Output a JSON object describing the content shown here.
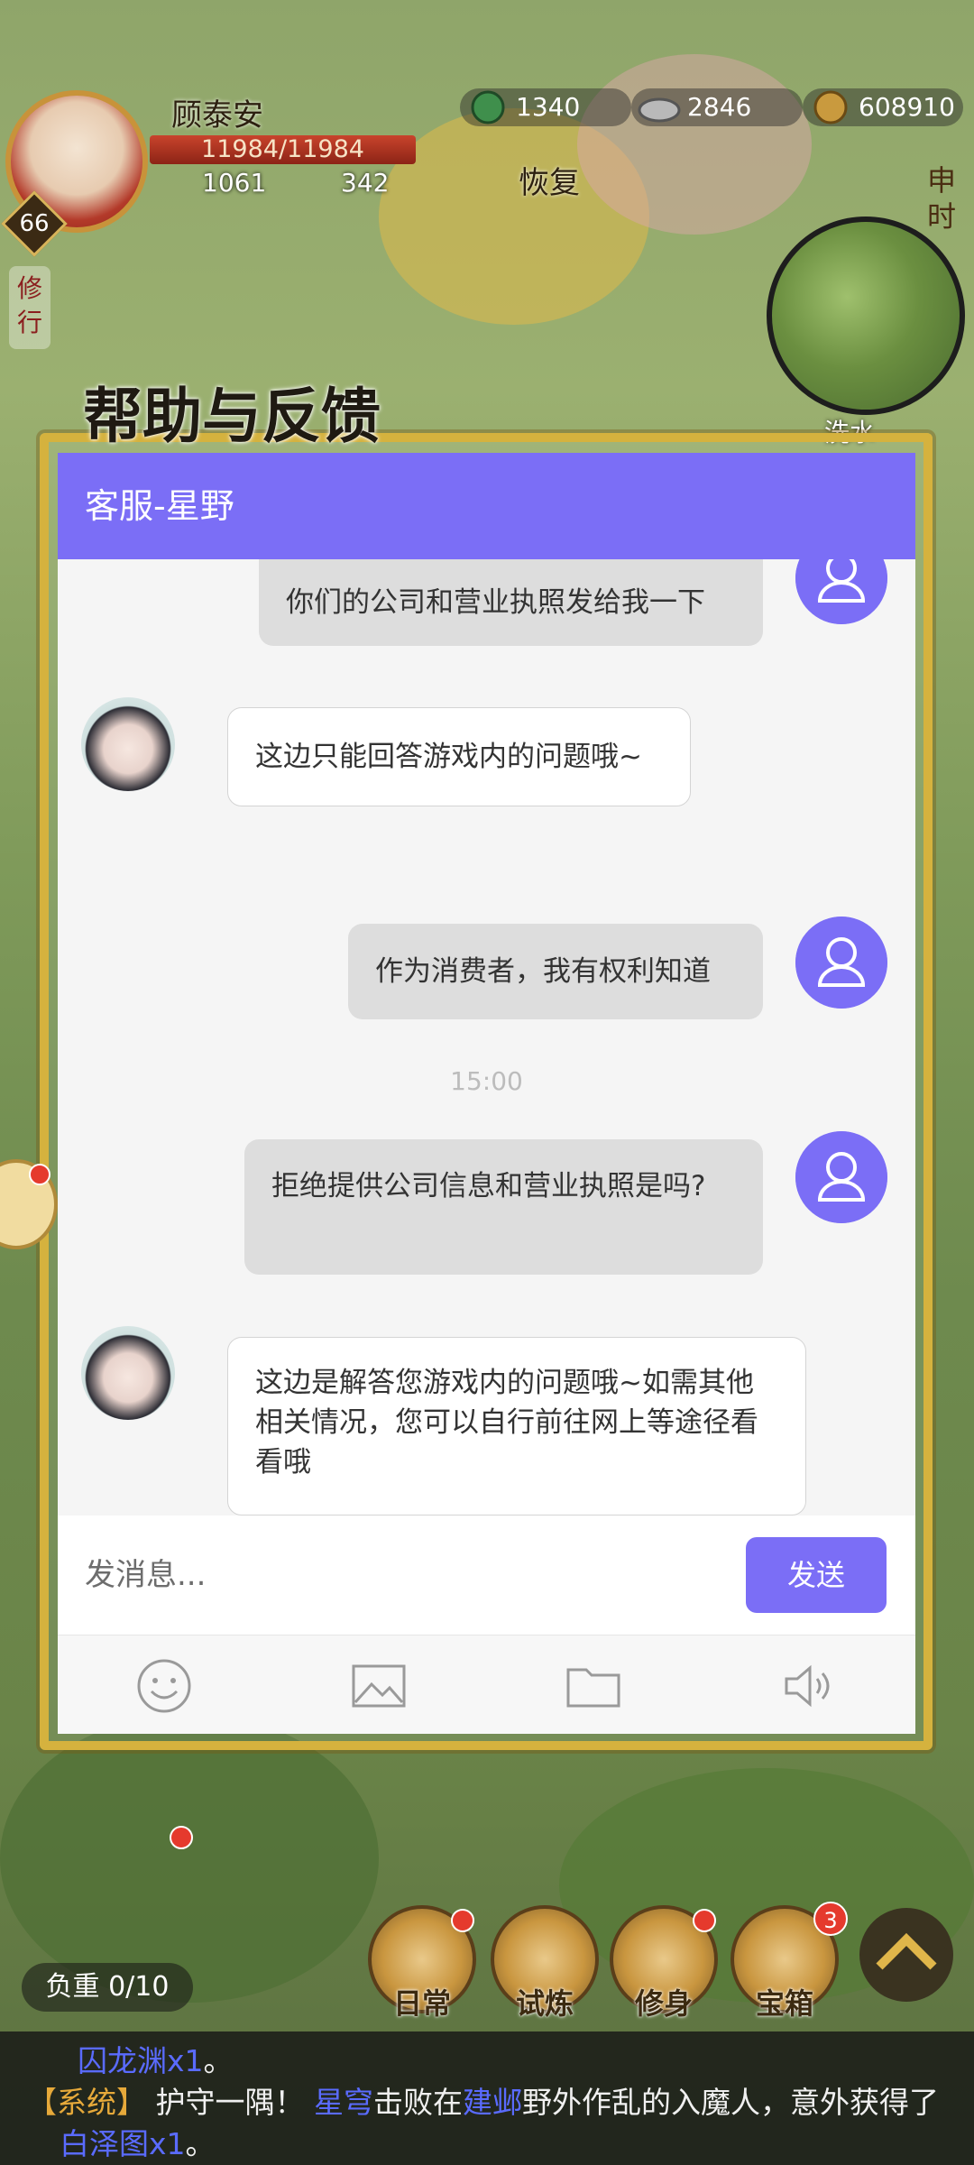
{
  "hud": {
    "player_name": "顾泰安",
    "hp": "11984/11984",
    "stat_a": "1061",
    "stat_b": "342",
    "level": "66",
    "currency_jade": "1340",
    "currency_silver": "2846",
    "currency_copper": "608910",
    "recover_label": "恢复",
    "cultivate_tag": "修行",
    "time_label": "申时",
    "map_label": "洗水"
  },
  "dialog": {
    "title": "帮助与反馈",
    "header": "客服-星野"
  },
  "messages": [
    {
      "sender": "user",
      "text": "你们的公司和营业执照发给我一下"
    },
    {
      "sender": "cs",
      "text": "这边只能回答游戏内的问题哦~"
    },
    {
      "sender": "user",
      "text": "作为消费者，我有权利知道"
    },
    {
      "sender": "timestamp",
      "text": "15:00"
    },
    {
      "sender": "user",
      "text": "拒绝提供公司信息和营业执照是吗?"
    },
    {
      "sender": "cs",
      "text": "这边是解答您游戏内的问题哦~如需其他相关情况，您可以自行前往网上等途径看看哦"
    }
  ],
  "input": {
    "placeholder": "发消息...",
    "send_label": "发送"
  },
  "toolbar": {
    "icons": [
      "emoji-icon",
      "image-icon",
      "folder-icon",
      "speaker-icon"
    ]
  },
  "bottom": {
    "weight": "负重 0/10",
    "menu": [
      "日常",
      "试炼",
      "修身",
      "宝箱"
    ],
    "treasure_count": "3"
  },
  "log": {
    "line1_item": "囚龙渊x1",
    "line1_end": "。",
    "line2_tag": "【系统】",
    "line2_a": "护守一隅！",
    "line2_name": "星穹",
    "line2_b": "击败在",
    "line2_place": "建邺",
    "line2_c": "野外作乱的入魔人，意外获得了",
    "line3_item": "白泽图x1",
    "line3_end": "。"
  },
  "colors": {
    "accent": "#7b6ef6",
    "frame_gold": "#d5b23e"
  }
}
